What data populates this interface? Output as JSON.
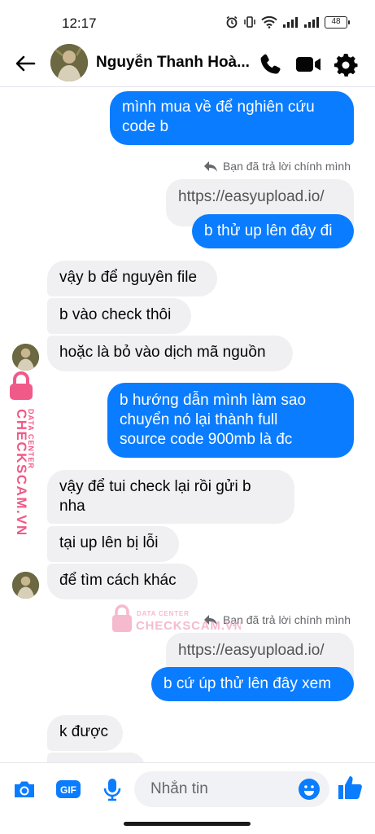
{
  "status": {
    "time": "12:17",
    "battery": "48"
  },
  "header": {
    "contact_name": "Nguyễn Thanh Hoà..."
  },
  "messages": [
    {
      "side": "out",
      "lines": [
        "mình mua về để nghiên cứu",
        "code b"
      ]
    },
    {
      "reply_note": "Bạn đã trả lời chính mình"
    },
    {
      "quote": "https://easyupload.io/"
    },
    {
      "side": "out",
      "lines": [
        "b thử up lên đây đi"
      ]
    },
    {
      "side": "in",
      "lines": [
        "vậy b để nguyên file"
      ]
    },
    {
      "side": "in",
      "lines": [
        "b vào check thôi"
      ]
    },
    {
      "side": "in",
      "lines": [
        "hoặc là bỏ vào dịch mã nguồn"
      ]
    },
    {
      "side": "out",
      "lines": [
        "b hướng dẫn mình làm sao",
        "chuyển nó lại thành full",
        "source code 900mb là đc"
      ]
    },
    {
      "side": "in",
      "lines": [
        "vậy để tui check lại rồi gửi b",
        "nha"
      ]
    },
    {
      "side": "in",
      "lines": [
        "tại up lên bị lỗi"
      ]
    },
    {
      "side": "in",
      "lines": [
        "để tìm cách khác"
      ]
    },
    {
      "reply_note": "Bạn đã trả lời chính mình"
    },
    {
      "quote": "https://easyupload.io/"
    },
    {
      "side": "out",
      "lines": [
        "b cứ úp thử lên đây xem"
      ]
    },
    {
      "side": "in",
      "lines": [
        "k được"
      ]
    }
  ],
  "watermark": {
    "line1": "DATA CENTER",
    "line2": "CHECKSCAM.VN"
  },
  "composer": {
    "placeholder": "Nhắn tin",
    "gif_label": "GIF"
  },
  "colors": {
    "accent": "#0a7cff",
    "incoming_bubble": "#f0f0f2",
    "watermark": "#f05a88"
  },
  "icons": [
    "back-arrow-icon",
    "phone-icon",
    "video-camera-icon",
    "gear-icon",
    "camera-icon",
    "gif-icon",
    "microphone-icon",
    "emoji-icon",
    "thumbs-up-icon",
    "reply-icon",
    "lock-icon"
  ]
}
